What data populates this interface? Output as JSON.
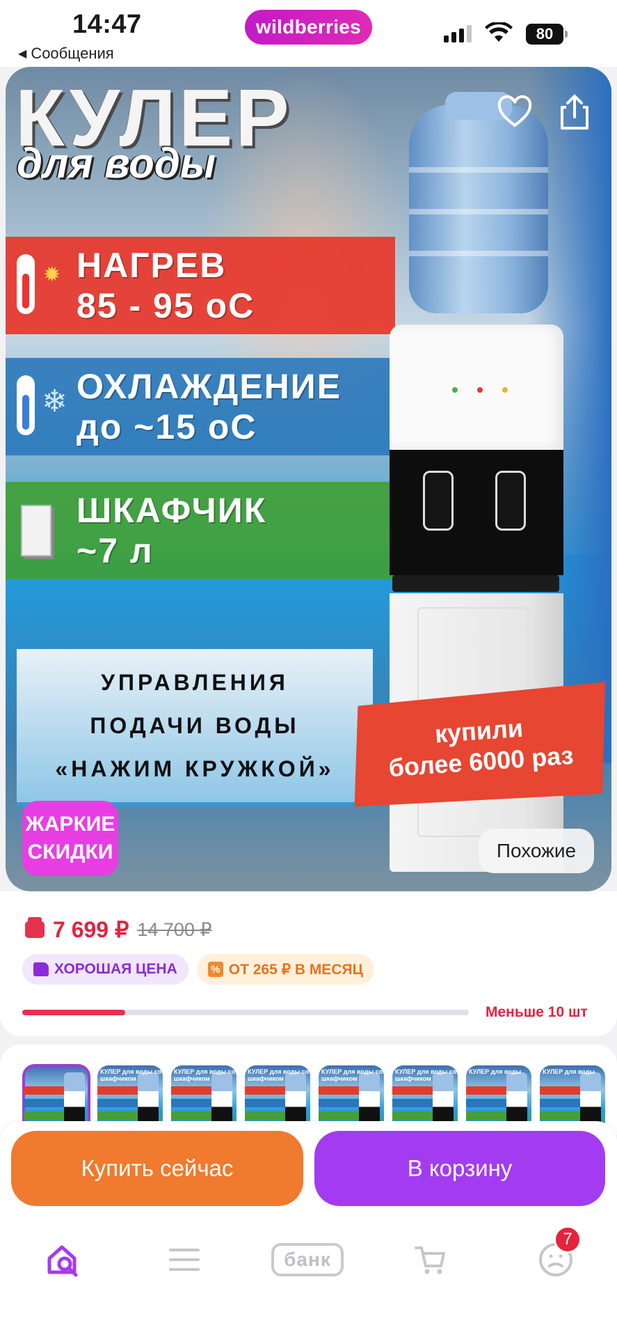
{
  "status_bar": {
    "time": "14:47",
    "back_app": "Сообщения",
    "brand": "wildberries",
    "battery": "80"
  },
  "product_image": {
    "title_main": "КУЛЕР",
    "title_sub": "для воды",
    "features": [
      {
        "line1": "НАГРЕВ",
        "line2": "85 - 95 оС",
        "color": "#e7382c",
        "icon": "thermometer-hot-icon"
      },
      {
        "line1": "ОХЛАЖДЕНИЕ",
        "line2": "до ~15 оС",
        "color": "#2876ba",
        "icon": "snowflake-icon"
      },
      {
        "line1": "ШКАФЧИК",
        "line2": "~7 л",
        "color": "#40a034",
        "icon": "cabinet-icon"
      }
    ],
    "control_text": [
      "УПРАВЛЕНИЯ",
      "ПОДАЧИ ВОДЫ",
      "«НАЖИМ КРУЖКОЙ»"
    ],
    "bought_ribbon": [
      "купили",
      "более 6000 раз"
    ],
    "hot_badge": [
      "ЖАРКИЕ",
      "СКИДКИ"
    ],
    "similar_label": "Похожие"
  },
  "price": {
    "current": "7 699 ₽",
    "old": "14 700 ₽",
    "chips": {
      "good_price": "ХОРОШАЯ ЦЕНА",
      "installment": "ОТ 265 ₽ В МЕСЯЦ"
    },
    "stock_text": "Меньше 10 шт",
    "stock_level_fraction": 0.23
  },
  "gallery": {
    "thumbnails": [
      {
        "caption": "",
        "selected": true
      },
      {
        "caption": "КУЛЕР для воды со шкафчиком",
        "selected": false
      },
      {
        "caption": "КУЛЕР для воды со шкафчиком",
        "selected": false
      },
      {
        "caption": "КУЛЕР для воды со шкафчиком",
        "selected": false
      },
      {
        "caption": "КУЛЕР для воды со шкафчиком",
        "selected": false
      },
      {
        "caption": "КУЛЕР для воды со шкафчиком",
        "selected": false
      },
      {
        "caption": "КУЛЕР для воды",
        "selected": false
      },
      {
        "caption": "КУЛЕР для воды",
        "selected": false
      }
    ]
  },
  "actions": {
    "buy_now": "Купить сейчас",
    "add_to_cart": "В корзину",
    "buy_color": "#f07a2d",
    "cart_color": "#a33cf0"
  },
  "tab_bar": {
    "items": [
      {
        "icon": "home-search-icon",
        "active": true
      },
      {
        "icon": "menu-icon",
        "active": false
      },
      {
        "icon": "bank-icon",
        "label": "банк",
        "active": false
      },
      {
        "icon": "cart-icon",
        "active": false
      },
      {
        "icon": "profile-icon",
        "active": false
      }
    ],
    "profile_badge": "7"
  }
}
